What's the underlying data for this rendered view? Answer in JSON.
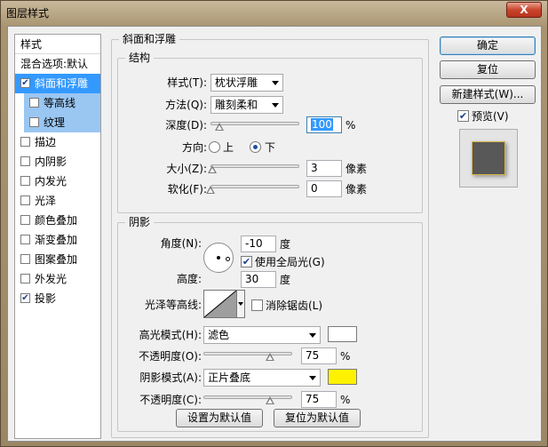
{
  "window": {
    "title": "图层样式",
    "close": "X"
  },
  "styles_panel": {
    "header": "样式",
    "blend_options": "混合选项:默认",
    "items": [
      {
        "label": "斜面和浮雕",
        "checked": true
      },
      {
        "label": "等高线",
        "checked": false
      },
      {
        "label": "纹理",
        "checked": false
      },
      {
        "label": "描边",
        "checked": false
      },
      {
        "label": "内阴影",
        "checked": false
      },
      {
        "label": "内发光",
        "checked": false
      },
      {
        "label": "光泽",
        "checked": false
      },
      {
        "label": "颜色叠加",
        "checked": false
      },
      {
        "label": "渐变叠加",
        "checked": false
      },
      {
        "label": "图案叠加",
        "checked": false
      },
      {
        "label": "外发光",
        "checked": false
      },
      {
        "label": "投影",
        "checked": true
      }
    ]
  },
  "bevel": {
    "group_title": "斜面和浮雕",
    "structure": {
      "title": "结构",
      "style_label": "样式(T):",
      "style_value": "枕状浮雕",
      "technique_label": "方法(Q):",
      "technique_value": "雕刻柔和",
      "depth_label": "深度(D):",
      "depth_value": "100",
      "depth_unit": "%",
      "depth_slider": 0.1,
      "direction_label": "方向:",
      "direction_up": "上",
      "direction_down": "下",
      "size_label": "大小(Z):",
      "size_value": "3",
      "size_unit": "像素",
      "size_slider": 0.02,
      "soften_label": "软化(F):",
      "soften_value": "0",
      "soften_unit": "像素",
      "soften_slider": 0.0
    },
    "shading": {
      "title": "阴影",
      "angle_label": "角度(N):",
      "angle_value": "-10",
      "angle_unit": "度",
      "global_light_label": "使用全局光(G)",
      "altitude_label": "高度:",
      "altitude_value": "30",
      "altitude_unit": "度",
      "gloss_label": "光泽等高线:",
      "antialias_label": "消除锯齿(L)",
      "highlight_mode_label": "高光模式(H):",
      "highlight_mode_value": "滤色",
      "highlight_color": "#ffffff",
      "highlight_opacity_label": "不透明度(O):",
      "highlight_opacity_value": "75",
      "highlight_opacity_slider": 0.75,
      "shadow_mode_label": "阴影模式(A):",
      "shadow_mode_value": "正片叠底",
      "shadow_color": "#fff200",
      "shadow_opacity_label": "不透明度(C):",
      "shadow_opacity_value": "75",
      "shadow_opacity_slider": 0.75,
      "percent": "%"
    },
    "make_default": "设置为默认值",
    "reset_default": "复位为默认值"
  },
  "actions": {
    "ok": "确定",
    "reset": "复位",
    "new_style": "新建样式(W)...",
    "preview": "预览(V)"
  },
  "colors": {
    "selection": "#3399ff",
    "sub_selection": "#9ac6f2"
  }
}
